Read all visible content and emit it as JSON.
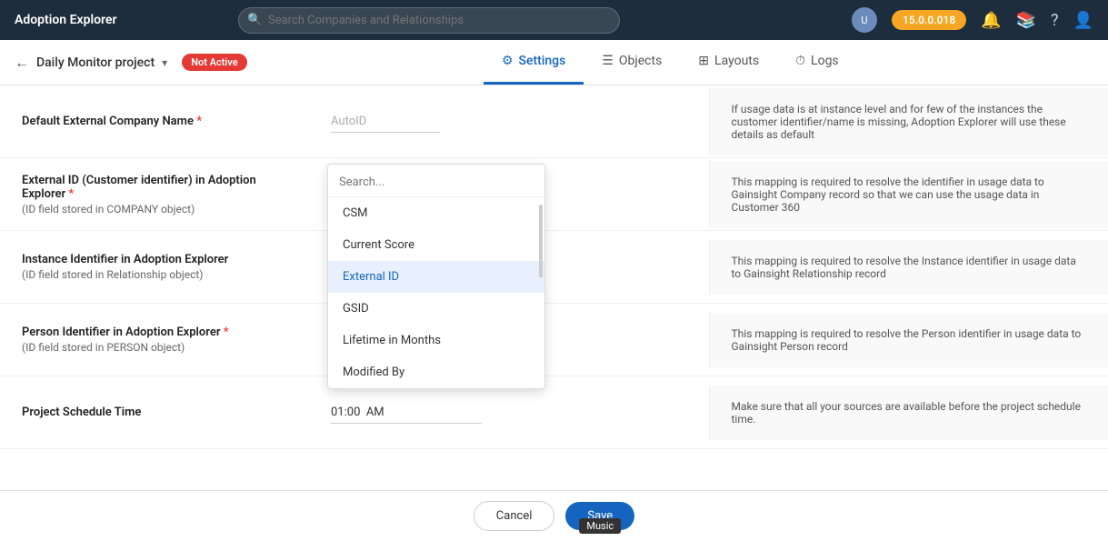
{
  "header": {
    "logo": "Adoption Explorer",
    "search_placeholder": "Search Companies and Relationships",
    "version": "15.0.0.018",
    "bell_icon": "🔔",
    "book_icon": "📚",
    "help_icon": "?",
    "profile_icon": "👤"
  },
  "sub_header": {
    "back_icon": "←",
    "project_name": "Daily Monitor project",
    "dropdown_icon": "▾",
    "status_badge": "Not Active",
    "tabs": [
      {
        "id": "settings",
        "label": "Settings",
        "icon": "⚙",
        "active": true
      },
      {
        "id": "objects",
        "label": "Objects",
        "icon": "☰",
        "active": false
      },
      {
        "id": "layouts",
        "label": "Layouts",
        "icon": "⊞",
        "active": false
      },
      {
        "id": "logs",
        "label": "Logs",
        "icon": "⏱",
        "active": false
      }
    ]
  },
  "settings": {
    "rows": [
      {
        "id": "default-external-company-name",
        "label": "Default External Company Name",
        "required": true,
        "sublabel": "",
        "value": "AutoID",
        "help": "If usage data is at instance level and for few of the instances the customer identifier/name is missing, Adoption Explorer will use these details as default"
      },
      {
        "id": "external-id",
        "label": "External ID (Customer identifier) in Adoption Explorer",
        "required": true,
        "sublabel": "(ID field stored in COMPANY object)",
        "value": "",
        "help": "This mapping is required to resolve the identifier in usage data to Gainsight Company record so that we can use the usage data in Customer 360"
      },
      {
        "id": "instance-identifier",
        "label": "Instance Identifier in Adoption Explorer",
        "required": false,
        "sublabel": "(ID field stored in Relationship object)",
        "value": "",
        "help": "This mapping is required to resolve the Instance identifier in usage data to Gainsight Relationship record"
      },
      {
        "id": "person-identifier",
        "label": "Person Identifier in Adoption Explorer",
        "required": true,
        "sublabel": "(ID field stored in PERSON object)",
        "value": "",
        "help": "This mapping is required to resolve the Person identifier in usage data to Gainsight Person record"
      },
      {
        "id": "project-schedule-time",
        "label": "Project Schedule Time",
        "required": false,
        "sublabel": "",
        "value": "01:00  AM",
        "help": "Make sure that all your sources are available before the project schedule time."
      }
    ]
  },
  "dropdown": {
    "search_placeholder": "Search...",
    "items": [
      {
        "id": "csm",
        "label": "CSM",
        "selected": false
      },
      {
        "id": "current-score",
        "label": "Current Score",
        "selected": false
      },
      {
        "id": "external-id",
        "label": "External ID",
        "selected": true
      },
      {
        "id": "gsid",
        "label": "GSID",
        "selected": false
      },
      {
        "id": "lifetime-in-months",
        "label": "Lifetime in Months",
        "selected": false
      },
      {
        "id": "modified-by",
        "label": "Modified By",
        "selected": false
      }
    ]
  },
  "footer": {
    "cancel_label": "Cancel",
    "save_label": "Save",
    "tooltip": "Music"
  }
}
